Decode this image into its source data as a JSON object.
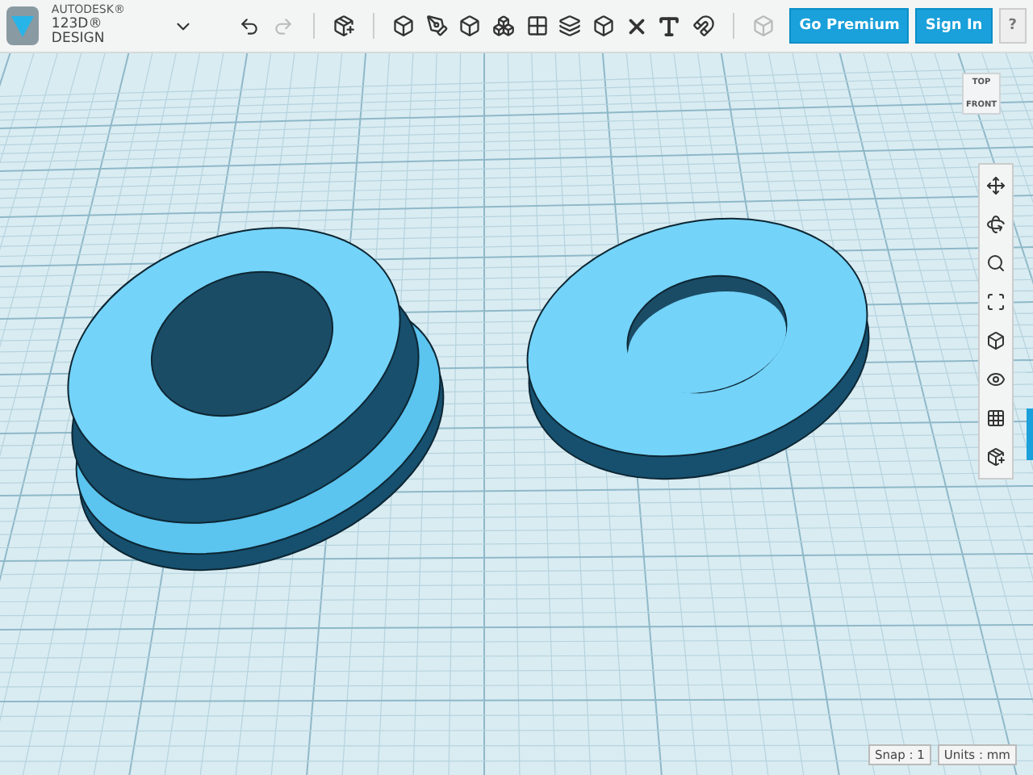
{
  "app": {
    "brand": "AUTODESK®",
    "product": "123D® DESIGN"
  },
  "header_buttons": [
    {
      "label": "Go Premium",
      "kind": "primary"
    },
    {
      "label": "Sign In",
      "kind": "primary"
    },
    {
      "label": "?",
      "kind": "help"
    }
  ],
  "view_cube": {
    "top": "TOP",
    "front": "FRONT"
  },
  "status_bar": [
    {
      "label": "Snap : 1"
    },
    {
      "label": "Units : mm"
    }
  ]
}
